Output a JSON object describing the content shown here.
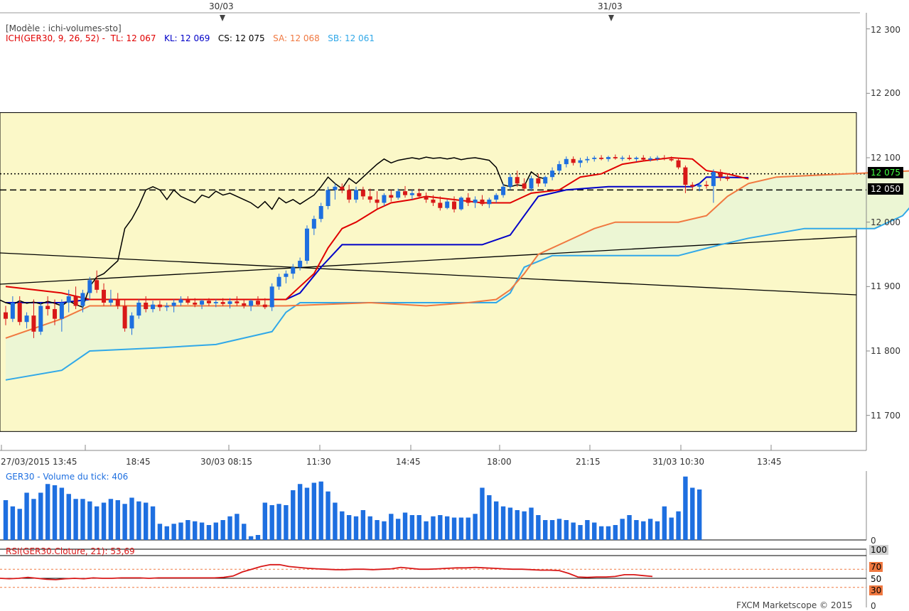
{
  "header": {
    "model_label": "[Modèle : ichi-volumes-sto]",
    "ich_prefix": "ICH(GER30, 9, 26, 52) -",
    "tl": "TL: 12 067",
    "kl": "KL: 12 069",
    "cs": "CS: 12 075",
    "sa": "SA: 12 068",
    "sb": "SB: 12 061"
  },
  "top_dates": [
    "30/03",
    "31/03"
  ],
  "x_axis_labels": [
    "27/03/2015 13:45",
    "18:45",
    "30/03 08:15",
    "11:30",
    "14:45",
    "18:00",
    "21:15",
    "31/03 10:30",
    "13:45"
  ],
  "y_axis_labels": [
    "12 300",
    "12 200",
    "12 100",
    "12 000",
    "11 900",
    "11 800",
    "11 700"
  ],
  "price_badges": {
    "last": "12 075",
    "level": "12 050"
  },
  "volume_panel": {
    "title": "GER30 - Volume du tick: 406",
    "zero_label": "0"
  },
  "rsi_panel": {
    "title": "RSI(GER30.Cloture, 21): 53,69",
    "levels": [
      "100",
      "70",
      "50",
      "30",
      "0"
    ]
  },
  "footer": {
    "copyright": "FXCM Marketscope © 2015"
  },
  "colors": {
    "background_zone": "#fbf8c8",
    "cloud_fill": "#ecf6d4",
    "tenkan": "#e00000",
    "kijun": "#0000c8",
    "senkou_a": "#f07840",
    "senkou_b": "#30a8e8",
    "chikou": "#000000",
    "bull_candle": "#1e6fe0",
    "bear_candle": "#d81818",
    "volume_bars": "#1e6fe0",
    "rsi_line": "#d81818"
  },
  "chart_data": [
    {
      "type": "candlestick",
      "title": "ICH(GER30, 9, 26, 52)",
      "ylim": [
        11650,
        12320
      ],
      "y_ticks": [
        11700,
        11800,
        11900,
        12000,
        12100,
        12200,
        12300
      ],
      "horizontal_levels": {
        "dotted": 12075,
        "dashed": 12050
      },
      "shaded_zone": [
        11675,
        12170
      ],
      "candles": [
        [
          11860,
          11870,
          11840,
          11850
        ],
        [
          11850,
          11885,
          11845,
          11875
        ],
        [
          11875,
          11885,
          11840,
          11845
        ],
        [
          11845,
          11860,
          11835,
          11855
        ],
        [
          11855,
          11880,
          11820,
          11830
        ],
        [
          11830,
          11875,
          11825,
          11870
        ],
        [
          11870,
          11885,
          11855,
          11865
        ],
        [
          11865,
          11880,
          11840,
          11850
        ],
        [
          11850,
          11880,
          11830,
          11875
        ],
        [
          11875,
          11895,
          11860,
          11885
        ],
        [
          11885,
          11900,
          11865,
          11870
        ],
        [
          11870,
          11895,
          11860,
          11890
        ],
        [
          11890,
          11915,
          11880,
          11910
        ],
        [
          11910,
          11925,
          11890,
          11895
        ],
        [
          11895,
          11905,
          11870,
          11875
        ],
        [
          11875,
          11895,
          11870,
          11880
        ],
        [
          11880,
          11890,
          11865,
          11870
        ],
        [
          11870,
          11880,
          11830,
          11835
        ],
        [
          11835,
          11860,
          11825,
          11855
        ],
        [
          11855,
          11880,
          11850,
          11875
        ],
        [
          11875,
          11885,
          11860,
          11865
        ],
        [
          11865,
          11878,
          11860,
          11872
        ],
        [
          11872,
          11878,
          11862,
          11868
        ],
        [
          11868,
          11875,
          11862,
          11870
        ],
        [
          11870,
          11880,
          11860,
          11875
        ],
        [
          11875,
          11885,
          11870,
          11880
        ],
        [
          11880,
          11885,
          11872,
          11875
        ],
        [
          11875,
          11882,
          11868,
          11872
        ],
        [
          11872,
          11880,
          11865,
          11878
        ],
        [
          11878,
          11882,
          11870,
          11874
        ],
        [
          11874,
          11880,
          11868,
          11876
        ],
        [
          11876,
          11882,
          11870,
          11873
        ],
        [
          11873,
          11882,
          11866,
          11877
        ],
        [
          11877,
          11885,
          11870,
          11874
        ],
        [
          11874,
          11880,
          11866,
          11870
        ],
        [
          11870,
          11880,
          11862,
          11878
        ],
        [
          11878,
          11885,
          11870,
          11872
        ],
        [
          11872,
          11882,
          11865,
          11868
        ],
        [
          11868,
          11905,
          11862,
          11900
        ],
        [
          11900,
          11920,
          11895,
          11915
        ],
        [
          11915,
          11925,
          11905,
          11920
        ],
        [
          11920,
          11935,
          11912,
          11930
        ],
        [
          11930,
          11945,
          11925,
          11940
        ],
        [
          11940,
          11995,
          11935,
          11990
        ],
        [
          11990,
          12010,
          11980,
          12005
        ],
        [
          12005,
          12030,
          12000,
          12025
        ],
        [
          12025,
          12055,
          12020,
          12050
        ],
        [
          12050,
          12060,
          12035,
          12055
        ],
        [
          12055,
          12060,
          12045,
          12050
        ],
        [
          12050,
          12058,
          12030,
          12035
        ],
        [
          12035,
          12055,
          12030,
          12050
        ],
        [
          12050,
          12055,
          12035,
          12040
        ],
        [
          12040,
          12052,
          12030,
          12035
        ],
        [
          12035,
          12048,
          12020,
          12030
        ],
        [
          12030,
          12045,
          12025,
          12042
        ],
        [
          12042,
          12050,
          12032,
          12038
        ],
        [
          12038,
          12052,
          12035,
          12048
        ],
        [
          12048,
          12056,
          12038,
          12042
        ],
        [
          12042,
          12050,
          12035,
          12045
        ],
        [
          12045,
          12052,
          12038,
          12040
        ],
        [
          12040,
          12046,
          12030,
          12035
        ],
        [
          12035,
          12042,
          12025,
          12030
        ],
        [
          12030,
          12040,
          12018,
          12022
        ],
        [
          12022,
          12035,
          12020,
          12032
        ],
        [
          12032,
          12040,
          12015,
          12020
        ],
        [
          12020,
          12040,
          12018,
          12038
        ],
        [
          12038,
          12045,
          12025,
          12030
        ],
        [
          12030,
          12040,
          12022,
          12035
        ],
        [
          12035,
          12042,
          12025,
          12028
        ],
        [
          12028,
          12038,
          12022,
          12035
        ],
        [
          12035,
          12045,
          12030,
          12042
        ],
        [
          12042,
          12060,
          12038,
          12055
        ],
        [
          12055,
          12075,
          12050,
          12070
        ],
        [
          12070,
          12080,
          12055,
          12060
        ],
        [
          12060,
          12068,
          12048,
          12052
        ],
        [
          12052,
          12072,
          12048,
          12068
        ],
        [
          12068,
          12075,
          12055,
          12060
        ],
        [
          12060,
          12072,
          12055,
          12070
        ],
        [
          12070,
          12085,
          12065,
          12080
        ],
        [
          12080,
          12095,
          12075,
          12090
        ],
        [
          12090,
          12102,
          12085,
          12098
        ],
        [
          12098,
          12102,
          12088,
          12092
        ],
        [
          12092,
          12100,
          12085,
          12096
        ],
        [
          12096,
          12102,
          12092,
          12098
        ],
        [
          12098,
          12103,
          12094,
          12100
        ],
        [
          12100,
          12104,
          12096,
          12098
        ],
        [
          12098,
          12103,
          12094,
          12101
        ],
        [
          12101,
          12105,
          12097,
          12099
        ],
        [
          12099,
          12103,
          12095,
          12100
        ],
        [
          12100,
          12104,
          12096,
          12098
        ],
        [
          12098,
          12102,
          12094,
          12100
        ],
        [
          12100,
          12104,
          12096,
          12097
        ],
        [
          12097,
          12102,
          12094,
          12099
        ],
        [
          12099,
          12103,
          12095,
          12100
        ],
        [
          12100,
          12104,
          12096,
          12098
        ],
        [
          12098,
          12102,
          12094,
          12096
        ],
        [
          12096,
          12100,
          12082,
          12085
        ],
        [
          12085,
          12088,
          12045,
          12058
        ],
        [
          12058,
          12062,
          12050,
          12055
        ],
        [
          12055,
          12062,
          12048,
          12058
        ],
        [
          12058,
          12064,
          12052,
          12056
        ],
        [
          12056,
          12082,
          12030,
          12078
        ],
        [
          12078,
          12082,
          12064,
          12070
        ],
        [
          12070,
          12075,
          12064,
          12067
        ]
      ],
      "tenkan": [
        [
          0,
          11900
        ],
        [
          8,
          11890
        ],
        [
          12,
          11880
        ],
        [
          40,
          11880
        ],
        [
          42,
          11900
        ],
        [
          44,
          11920
        ],
        [
          46,
          11960
        ],
        [
          48,
          11990
        ],
        [
          50,
          12000
        ],
        [
          53,
          12020
        ],
        [
          55,
          12030
        ],
        [
          58,
          12035
        ],
        [
          60,
          12040
        ],
        [
          68,
          12030
        ],
        [
          72,
          12030
        ],
        [
          75,
          12045
        ],
        [
          79,
          12050
        ],
        [
          82,
          12070
        ],
        [
          85,
          12075
        ],
        [
          88,
          12090
        ],
        [
          91,
          12095
        ],
        [
          95,
          12100
        ],
        [
          98,
          12098
        ],
        [
          100,
          12080
        ],
        [
          103,
          12075
        ],
        [
          106,
          12067
        ]
      ],
      "kijun": [
        [
          0,
          11875
        ],
        [
          8,
          11875
        ],
        [
          12,
          11880
        ],
        [
          40,
          11880
        ],
        [
          42,
          11890
        ],
        [
          45,
          11930
        ],
        [
          48,
          11965
        ],
        [
          60,
          11965
        ],
        [
          68,
          11965
        ],
        [
          72,
          11980
        ],
        [
          74,
          12010
        ],
        [
          76,
          12040
        ],
        [
          80,
          12050
        ],
        [
          86,
          12055
        ],
        [
          98,
          12055
        ],
        [
          99,
          12060
        ],
        [
          100,
          12070
        ],
        [
          106,
          12069
        ]
      ],
      "senkou_a": [
        [
          0,
          11820
        ],
        [
          8,
          11850
        ],
        [
          12,
          11870
        ],
        [
          40,
          11870
        ],
        [
          52,
          11875
        ],
        [
          60,
          11870
        ],
        [
          66,
          11875
        ],
        [
          70,
          11880
        ],
        [
          72,
          11895
        ],
        [
          74,
          11920
        ],
        [
          76,
          11950
        ],
        [
          80,
          11970
        ],
        [
          84,
          11990
        ],
        [
          87,
          12000
        ],
        [
          96,
          12000
        ],
        [
          100,
          12010
        ],
        [
          103,
          12040
        ],
        [
          106,
          12060
        ],
        [
          110,
          12070
        ],
        [
          120,
          12075
        ],
        [
          130,
          12080
        ],
        [
          138,
          12075
        ],
        [
          142,
          12068
        ]
      ],
      "senkou_b": [
        [
          0,
          11755
        ],
        [
          8,
          11770
        ],
        [
          12,
          11800
        ],
        [
          22,
          11805
        ],
        [
          30,
          11810
        ],
        [
          38,
          11830
        ],
        [
          40,
          11860
        ],
        [
          42,
          11875
        ],
        [
          70,
          11875
        ],
        [
          72,
          11890
        ],
        [
          74,
          11930
        ],
        [
          78,
          11948
        ],
        [
          96,
          11948
        ],
        [
          102,
          11965
        ],
        [
          106,
          11975
        ],
        [
          114,
          11990
        ],
        [
          124,
          11990
        ],
        [
          128,
          12010
        ],
        [
          130,
          12035
        ],
        [
          132,
          12055
        ],
        [
          142,
          12061
        ]
      ]
    },
    {
      "type": "bar",
      "title": "GER30 - Volume du tick: 406",
      "values": [
        320,
        270,
        250,
        380,
        330,
        380,
        450,
        440,
        420,
        370,
        330,
        330,
        310,
        270,
        300,
        330,
        320,
        290,
        340,
        310,
        300,
        270,
        130,
        110,
        130,
        140,
        160,
        150,
        140,
        120,
        140,
        160,
        190,
        210,
        130,
        30,
        40,
        300,
        280,
        290,
        280,
        400,
        450,
        420,
        460,
        470,
        390,
        300,
        230,
        200,
        190,
        240,
        190,
        160,
        150,
        210,
        170,
        220,
        200,
        200,
        150,
        190,
        200,
        190,
        180,
        180,
        180,
        210,
        420,
        360,
        310,
        270,
        260,
        240,
        230,
        260,
        200,
        160,
        160,
        170,
        160,
        140,
        120,
        160,
        140,
        110,
        110,
        120,
        170,
        200,
        160,
        150,
        170,
        150,
        270,
        180,
        230,
        510,
        420,
        406
      ],
      "ylim": [
        0,
        520
      ]
    },
    {
      "type": "line",
      "title": "RSI(GER30.Cloture, 21): 53,69",
      "ylim": [
        0,
        100
      ],
      "reference_levels": [
        100,
        70,
        50,
        30,
        0
      ],
      "values": [
        50,
        49,
        50,
        52,
        50,
        48,
        47,
        49,
        50,
        49,
        51,
        50,
        50,
        51,
        51,
        51,
        50,
        51,
        51,
        51,
        51,
        51,
        51,
        51,
        52,
        55,
        64,
        70,
        76,
        80,
        80,
        76,
        74,
        72,
        71,
        70,
        69,
        69,
        70,
        70,
        69,
        70,
        71,
        74,
        72,
        70,
        70,
        71,
        72,
        73,
        73,
        74,
        73,
        72,
        71,
        70,
        70,
        69,
        68,
        68,
        67,
        61,
        53,
        52,
        53,
        53,
        54,
        58,
        58,
        56,
        54
      ]
    }
  ]
}
